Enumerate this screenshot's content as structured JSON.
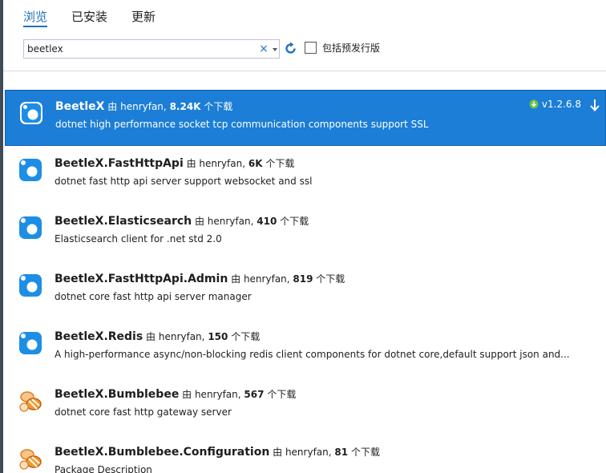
{
  "tabs": [
    {
      "label": "浏览"
    },
    {
      "label": "已安装"
    },
    {
      "label": "更新"
    }
  ],
  "search": {
    "value": "beetlex",
    "clear_glyph": "×"
  },
  "prerelease_label": "包括预发行版",
  "colors": {
    "accent": "#1e73be",
    "selected_bg": "#1c7ed6"
  },
  "packages": [
    {
      "name": "BeetleX",
      "by": "由 henryfan,",
      "downloads": "8.24K",
      "downloads_suffix": "个下载",
      "description": "dotnet high performance socket tcp communication components support SSL",
      "version": "v1.2.6.8",
      "icon": "beetlex-blue-icon",
      "selected": true
    },
    {
      "name": "BeetleX.FastHttpApi",
      "by": "由 henryfan,",
      "downloads": "6K",
      "downloads_suffix": "个下载",
      "description": "dotnet fast http api server support websocket and ssl",
      "icon": "beetlex-blue-icon"
    },
    {
      "name": "BeetleX.Elasticsearch",
      "by": "由 henryfan,",
      "downloads": "410",
      "downloads_suffix": "个下载",
      "description": "Elasticsearch client for .net std 2.0",
      "icon": "beetlex-blue-icon"
    },
    {
      "name": "BeetleX.FastHttpApi.Admin",
      "by": "由 henryfan,",
      "downloads": "819",
      "downloads_suffix": "个下载",
      "description": "dotnet core fast http api server manager",
      "icon": "beetlex-blue-icon"
    },
    {
      "name": "BeetleX.Redis",
      "by": "由 henryfan,",
      "downloads": "150",
      "downloads_suffix": "个下载",
      "description": "A high-performance async/non-blocking  redis client components for dotnet core,default support json and...",
      "icon": "beetlex-blue-icon"
    },
    {
      "name": "BeetleX.Bumblebee",
      "by": "由 henryfan,",
      "downloads": "567",
      "downloads_suffix": "个下载",
      "description": "dotnet core fast http gateway server",
      "icon": "bumblebee-icon"
    },
    {
      "name": "BeetleX.Bumblebee.Configuration",
      "by": "由 henryfan,",
      "downloads": "81",
      "downloads_suffix": "个下载",
      "description": "Package Description",
      "icon": "bumblebee-icon"
    }
  ]
}
